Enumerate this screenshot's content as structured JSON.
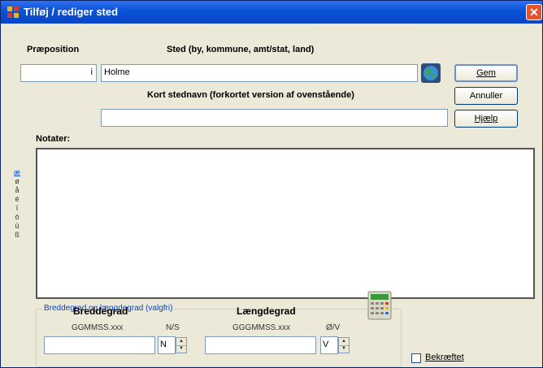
{
  "window": {
    "title": "Tilføj / rediger sted",
    "close_glyph": "✕"
  },
  "labels": {
    "preposition": "Præposition",
    "place": "Sted (by, kommune, amt/stat, land)",
    "short_name": "Kort stednavn (forkortet version af ovenstående)",
    "notes": "Notater:"
  },
  "fields": {
    "preposition_value": "i",
    "place_value": "Holme",
    "short_name_value": "",
    "notes_value": ""
  },
  "buttons": {
    "save": "Gem",
    "cancel": "Annuller",
    "help": "Hjælp"
  },
  "sidebar_chars": [
    "æ",
    "ø",
    "å",
    "é",
    "ï",
    "ó",
    "ü",
    "ß"
  ],
  "coords": {
    "group_title": "Breddegrad og længdegrad (valgfri)",
    "lat_label": "Breddegrad",
    "lat_format": "GGMMSS.xxx",
    "ns_label": "N/S",
    "ns_value": "N",
    "lon_label": "Længdegrad",
    "lon_format": "GGGMMSS.xxx",
    "ew_label": "Ø/V",
    "ew_value": "V"
  },
  "checkbox": {
    "label": "Bekræftet",
    "checked": false
  },
  "colors": {
    "accent": "#0046d5",
    "titlebar": "#0b52d6",
    "face": "#ece9d8"
  },
  "icons": {
    "title": "app-icon",
    "globe": "globe-icon",
    "calc": "calculator-icon"
  }
}
